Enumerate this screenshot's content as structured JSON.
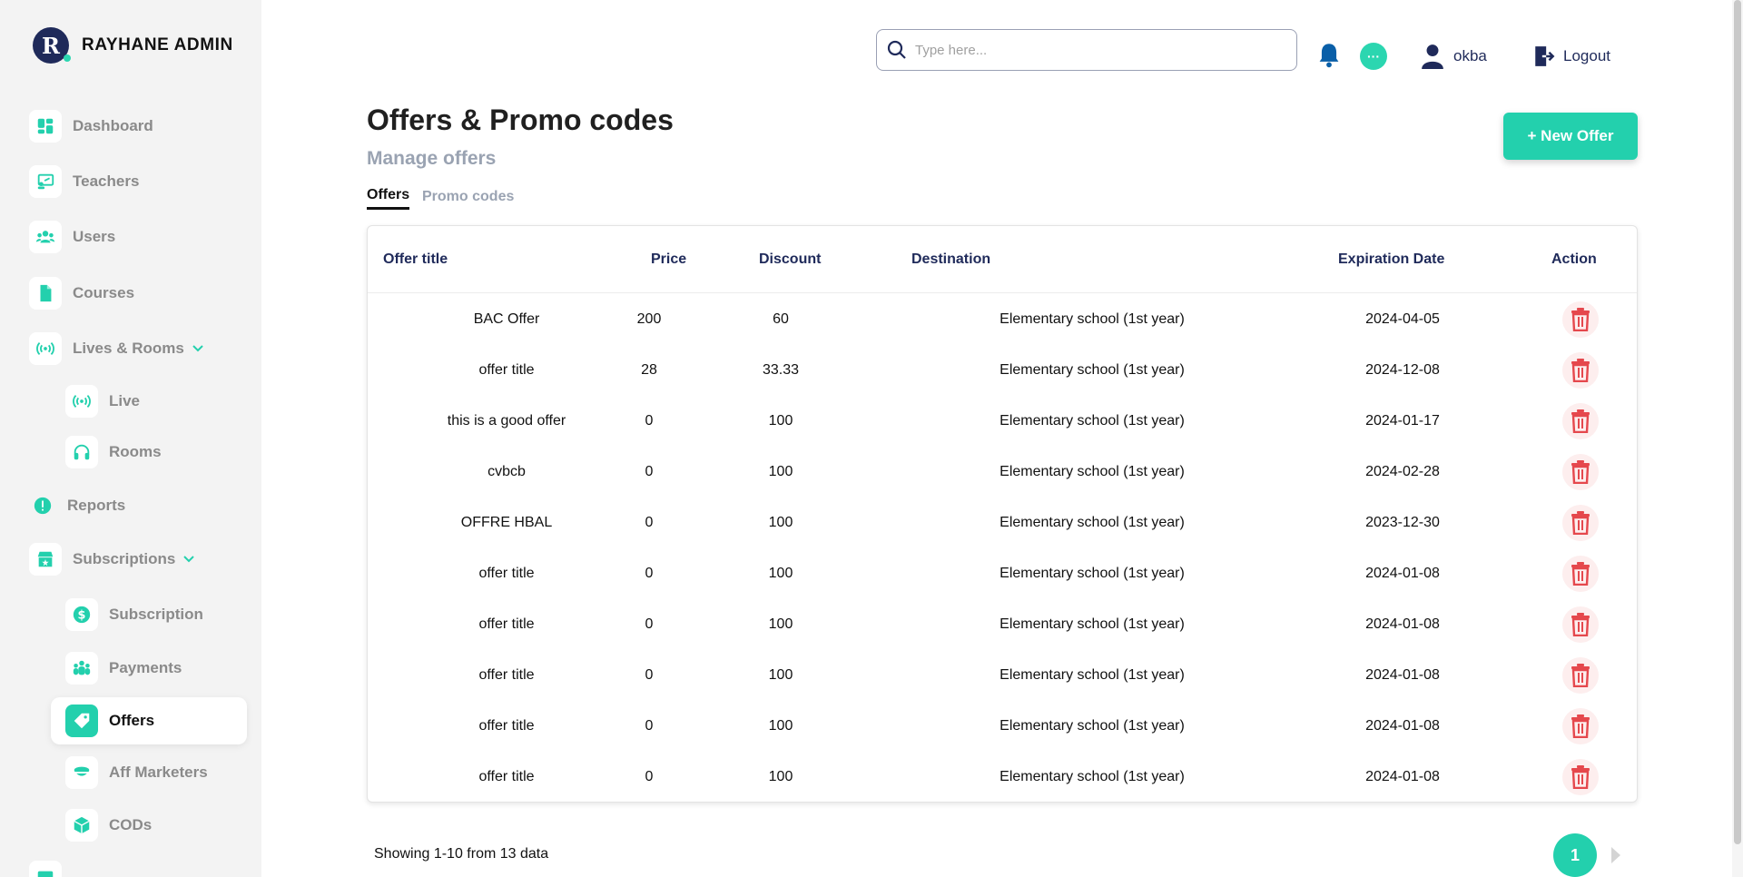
{
  "brand": {
    "name": "RAYHANE ADMIN",
    "logo_letter": "R"
  },
  "sidebar": {
    "items": [
      {
        "label": "Dashboard",
        "icon": "dashboard-icon"
      },
      {
        "label": "Teachers",
        "icon": "teacher-icon"
      },
      {
        "label": "Users",
        "icon": "users-icon"
      },
      {
        "label": "Courses",
        "icon": "document-icon"
      },
      {
        "label": "Lives & Rooms",
        "icon": "broadcast-icon"
      },
      {
        "label": "Live",
        "icon": "broadcast-icon"
      },
      {
        "label": "Rooms",
        "icon": "headphones-icon"
      },
      {
        "label": "Reports",
        "icon": "alert-icon"
      },
      {
        "label": "Subscriptions",
        "icon": "store-icon"
      },
      {
        "label": "Subscription",
        "icon": "dollar-icon"
      },
      {
        "label": "Payments",
        "icon": "group-icon"
      },
      {
        "label": "Offers",
        "icon": "tag-icon"
      },
      {
        "label": "Aff Marketers",
        "icon": "bowl-icon"
      },
      {
        "label": "CODs",
        "icon": "box-icon"
      }
    ]
  },
  "header": {
    "search_placeholder": "Type here...",
    "user_name": "okba",
    "logout_label": "Logout",
    "chat_glyph": "···"
  },
  "page": {
    "title": "Offers & Promo codes",
    "subtitle": "Manage offers",
    "new_offer_label": "+ New Offer",
    "tabs": [
      {
        "label": "Offers",
        "active": true
      },
      {
        "label": "Promo codes",
        "active": false
      }
    ]
  },
  "table": {
    "columns": [
      "Offer title",
      "Price",
      "Discount",
      "Destination",
      "Expiration Date",
      "Action"
    ],
    "rows": [
      {
        "title": "BAC Offer",
        "price": "200",
        "discount": "60",
        "destination": "Elementary school (1st year)",
        "date": "2024-04-05"
      },
      {
        "title": "offer title",
        "price": "28",
        "discount": "33.33",
        "destination": "Elementary school (1st year)",
        "date": "2024-12-08"
      },
      {
        "title": "this is a good offer",
        "price": "0",
        "discount": "100",
        "destination": "Elementary school (1st year)",
        "date": "2024-01-17"
      },
      {
        "title": "cvbcb",
        "price": "0",
        "discount": "100",
        "destination": "Elementary school (1st year)",
        "date": "2024-02-28"
      },
      {
        "title": "OFFRE HBAL",
        "price": "0",
        "discount": "100",
        "destination": "Elementary school (1st year)",
        "date": "2023-12-30"
      },
      {
        "title": "offer title",
        "price": "0",
        "discount": "100",
        "destination": "Elementary school (1st year)",
        "date": "2024-01-08"
      },
      {
        "title": "offer title",
        "price": "0",
        "discount": "100",
        "destination": "Elementary school (1st year)",
        "date": "2024-01-08"
      },
      {
        "title": "offer title",
        "price": "0",
        "discount": "100",
        "destination": "Elementary school (1st year)",
        "date": "2024-01-08"
      },
      {
        "title": "offer title",
        "price": "0",
        "discount": "100",
        "destination": "Elementary school (1st year)",
        "date": "2024-01-08"
      },
      {
        "title": "offer title",
        "price": "0",
        "discount": "100",
        "destination": "Elementary school (1st year)",
        "date": "2024-01-08"
      }
    ]
  },
  "pagination": {
    "summary": "Showing 1-10 from 13 data",
    "current_page": "1"
  },
  "colors": {
    "accent": "#23d0ad",
    "navy": "#1f2a5a",
    "danger": "#e5484d"
  }
}
